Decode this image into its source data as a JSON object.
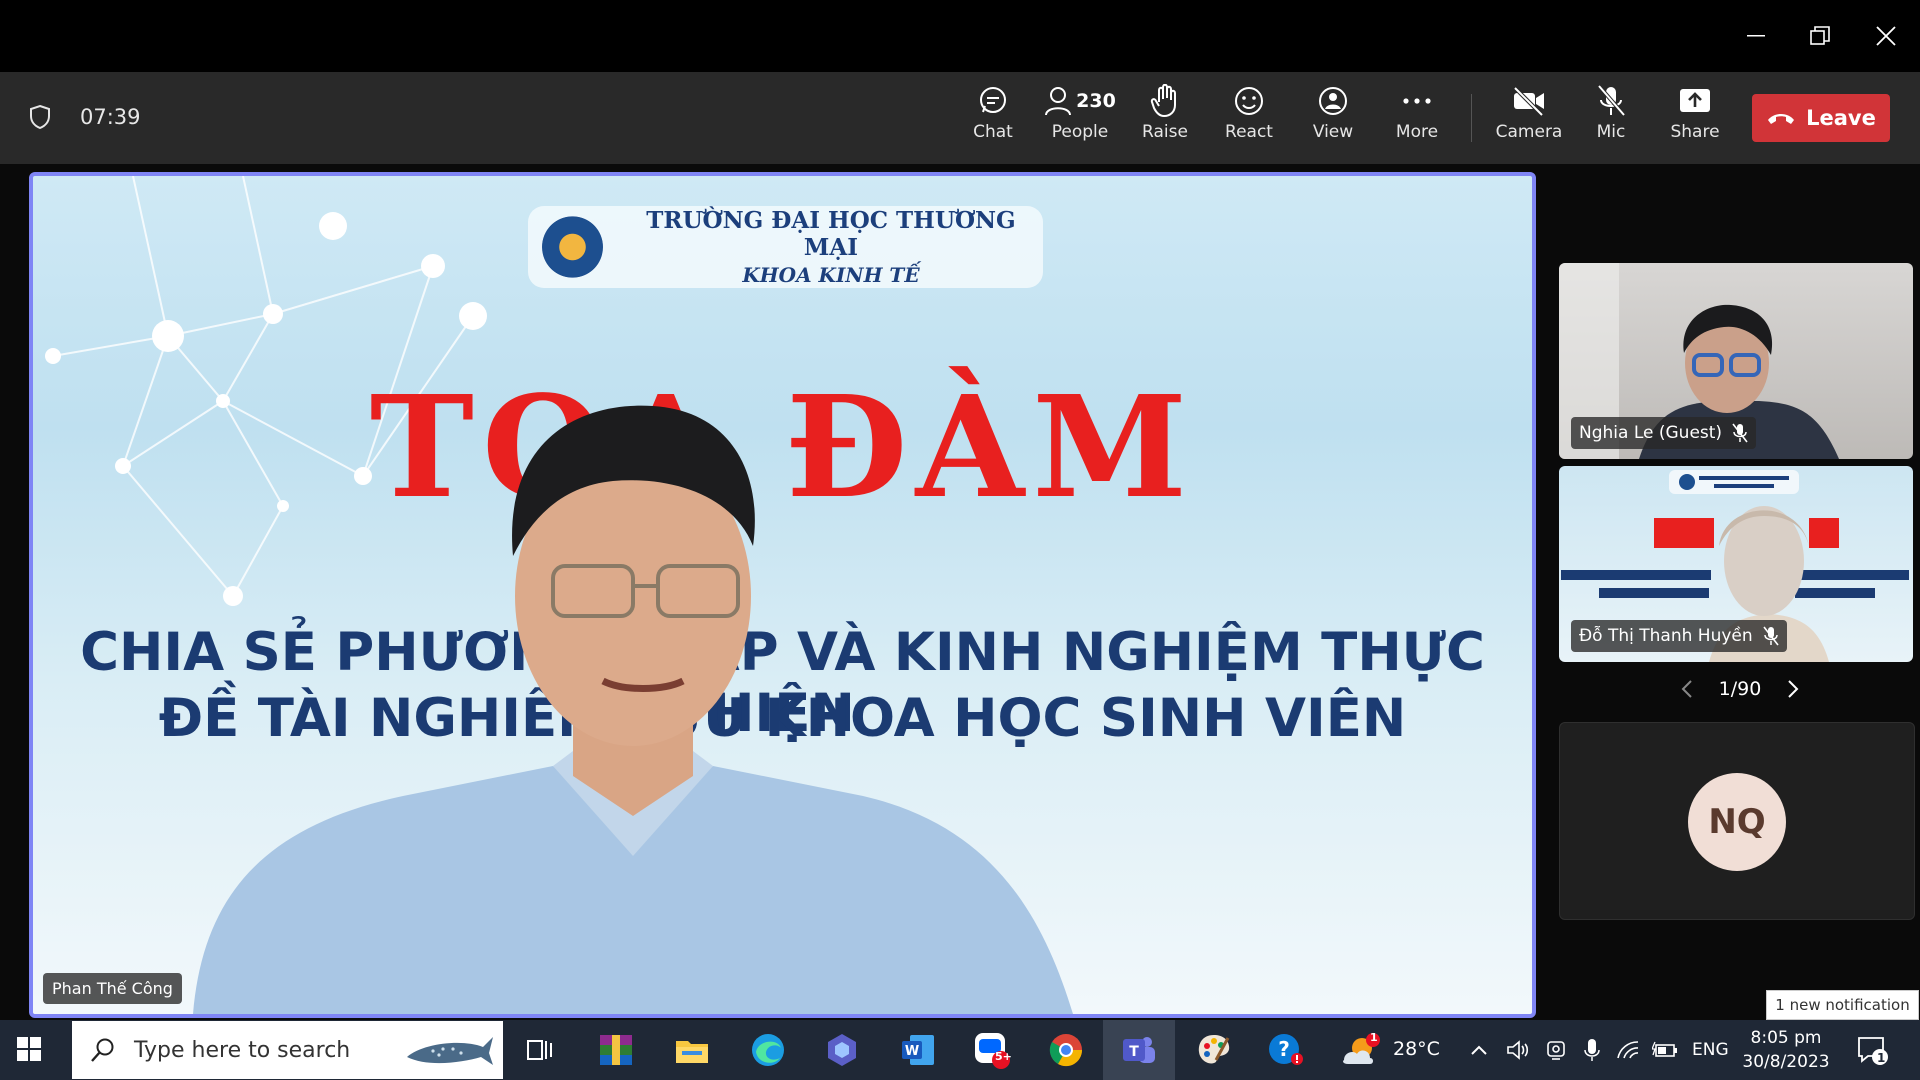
{
  "meeting": {
    "timer": "07:39",
    "toolbar": {
      "chat": "Chat",
      "people": "People",
      "people_count": "230",
      "raise": "Raise",
      "react": "React",
      "view": "View",
      "more": "More",
      "camera": "Camera",
      "mic": "Mic",
      "share": "Share",
      "leave": "Leave"
    }
  },
  "main_video": {
    "speaker_name": "Phan Thế Công",
    "slide": {
      "logo_line1": "TRƯỜNG ĐẠI HỌC THƯƠNG MẠI",
      "logo_line2": "KHOA KINH TẾ",
      "title": "TỌA ĐÀM",
      "subtitle_line1": "CHIA SẺ PHƯƠNG PHÁP VÀ KINH NGHIỆM THỰC HIỆN",
      "subtitle_line2": "ĐỀ TÀI NGHIÊN CỨU KHOA HỌC SINH VIÊN"
    }
  },
  "participants": [
    {
      "name": "Nghia Le (Guest)",
      "muted": true
    },
    {
      "name": "Đỗ Thị Thanh Huyền",
      "muted": true
    },
    {
      "initials": "NQ"
    }
  ],
  "pager": {
    "text": "1/90"
  },
  "notification": {
    "text": "1 new notification"
  },
  "taskbar": {
    "search_placeholder": "Type here to search",
    "weather": "28°C",
    "language": "ENG",
    "time": "8:05 pm",
    "date": "30/8/2023",
    "zalo_badge": "5+",
    "weather_badge": "1",
    "notif_count": "1"
  },
  "colors": {
    "leave": "#d13438",
    "active_border": "#7f85f5",
    "toolbar": "#292929",
    "taskbar": "#1f2836"
  }
}
